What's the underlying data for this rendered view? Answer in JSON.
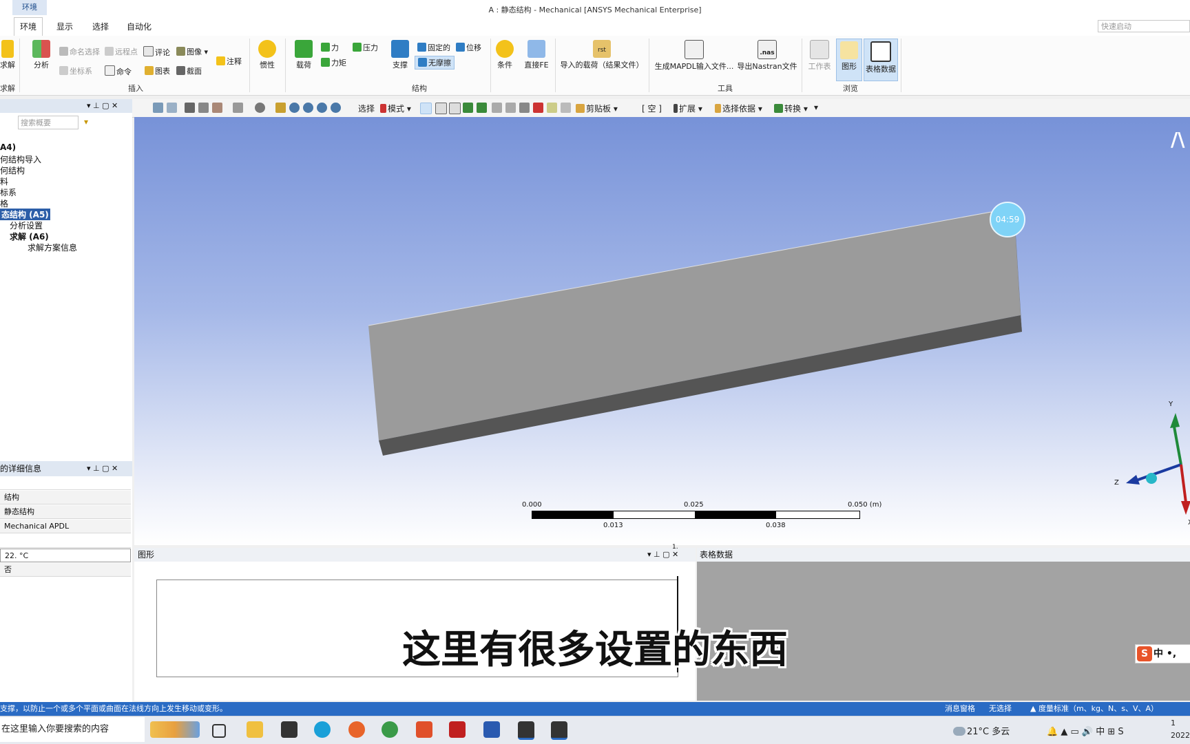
{
  "window": {
    "context_tab": "环境",
    "title": "A : 静态结构 - Mechanical [ANSYS Mechanical Enterprise]",
    "quick_launch_placeholder": "快速启动"
  },
  "tabs": [
    {
      "label": "环境",
      "active": true
    },
    {
      "label": "显示"
    },
    {
      "label": "选择"
    },
    {
      "label": "自动化"
    }
  ],
  "ribbon": {
    "solve_label": "求解",
    "solve_group": "求解",
    "analysis_label": "分析",
    "named_selection": "命名选择",
    "remote_point": "远程点",
    "comment": "评论",
    "image": "图像",
    "coordinate_system": "坐标系",
    "command": "命令",
    "chart": "图表",
    "section": "截面",
    "annotation": "注释",
    "insert_group": "插入",
    "inertial": "惯性",
    "loads": "载荷",
    "force": "力",
    "moment": "力矩",
    "pressure": "压力",
    "supports": "支撑",
    "fixed": "固定的",
    "displacement": "位移",
    "frictionless": "无摩擦",
    "structural_group": "结构",
    "conditions": "条件",
    "direct_fe": "直接FE",
    "imported_loads": "导入的载荷（结果文件）",
    "write_mapdl": "生成MAPDL输入文件...",
    "export_nastran": "导出Nastran文件",
    "tools_group": "工具",
    "worksheet": "工作表",
    "graph": "图形",
    "tabular": "表格数据",
    "browse_group": "浏览",
    "nas_caption": ".nas",
    "rst_caption": "rst"
  },
  "outline": {
    "search_placeholder": "搜索概要",
    "nodes": [
      {
        "label": "A4)"
      },
      {
        "label": "何结构导入"
      },
      {
        "label": "何结构"
      },
      {
        "label": "料"
      },
      {
        "label": "标系"
      },
      {
        "label": "格"
      },
      {
        "label": "态结构 (A5)",
        "selected": true
      },
      {
        "label": "分析设置"
      },
      {
        "label": "求解 (A6)"
      },
      {
        "label": "求解方案信息"
      }
    ]
  },
  "details": {
    "title": "的详细信息",
    "rows": [
      "",
      "结构",
      "静态结构",
      "Mechanical APDL",
      "",
      "22. °C",
      "否"
    ]
  },
  "view_toolbar": {
    "select": "选择",
    "mode": "模式",
    "clipboard": "剪贴板",
    "empty": "[ 空 ]",
    "extend": "扩展",
    "select_by": "选择依据",
    "convert": "转换"
  },
  "viewport": {
    "timer": "04:59",
    "scale_top": [
      "0.000",
      "0.025",
      "0.050 (m)"
    ],
    "scale_bottom": [
      "0.013",
      "0.038"
    ],
    "axes": {
      "y": "Y",
      "z": "Z",
      "x": "X"
    },
    "logo": "/\\"
  },
  "graph_pane": {
    "title": "图形",
    "axis_value": "1."
  },
  "table_pane": {
    "title": "表格数据"
  },
  "subtitle": "这里有很多设置的东西",
  "statusbar": {
    "hint": "支撑，以防止一个或多个平面或曲面在法线方向上发生移动或变形。",
    "messages": "消息窗格",
    "selection": "无选择",
    "units": "度量标准（m、kg、N、s、V、A）",
    "ime": "中",
    "ime2": "•,"
  },
  "taskbar": {
    "search": "在这里输入你要搜索的内容",
    "weather": "21°C  多云",
    "tray_ime": "中",
    "date": "2022",
    "time": "1"
  },
  "colors": {
    "accent": "#2a6bc4",
    "part_top": "#9b9b9b",
    "part_side": "#555555",
    "timer": "#7fd3f7"
  }
}
